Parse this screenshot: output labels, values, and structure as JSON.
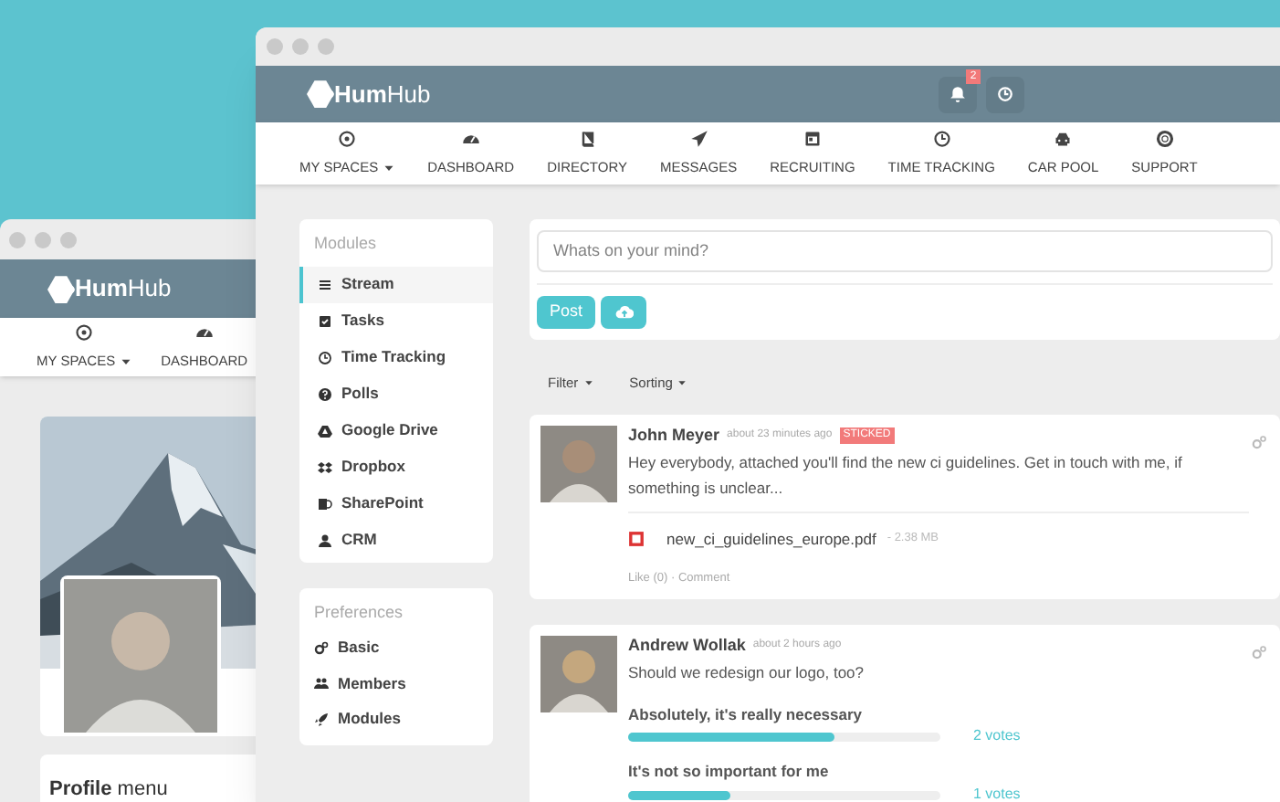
{
  "back_window": {
    "logo": "**Hum**Hub",
    "nav": [
      {
        "label": "MY SPACES",
        "dropdown": true
      },
      {
        "label": "DASHBOARD",
        "dropdown": false
      }
    ],
    "profile_menu": "**Profile** menu"
  },
  "window": {
    "logo": "**Hum**Hub",
    "notification_count": "2",
    "nav": [
      {
        "label": "MY SPACES",
        "dropdown": true
      },
      {
        "label": "DASHBOARD",
        "dropdown": false
      },
      {
        "label": "DIRECTORY",
        "dropdown": false
      },
      {
        "label": "MESSAGES",
        "dropdown": false
      },
      {
        "label": "RECRUITING",
        "dropdown": false
      },
      {
        "label": "TIME TRACKING",
        "dropdown": false
      },
      {
        "label": "CAR POOL",
        "dropdown": false
      },
      {
        "label": "SUPPORT",
        "dropdown": false
      }
    ]
  },
  "sidebar": {
    "modules_heading": "Modules",
    "modules": [
      {
        "label": "Stream",
        "selected": true
      },
      {
        "label": "Tasks",
        "selected": false
      },
      {
        "label": "Time Tracking",
        "selected": false
      },
      {
        "label": "Polls",
        "selected": false
      },
      {
        "label": "Google Drive",
        "selected": false
      },
      {
        "label": "Dropbox",
        "selected": false
      },
      {
        "label": "SharePoint",
        "selected": false
      },
      {
        "label": "CRM",
        "selected": false
      }
    ],
    "preferences_heading": "Preferences",
    "preferences": [
      {
        "label": "Basic"
      },
      {
        "label": "Members"
      },
      {
        "label": "Modules"
      }
    ]
  },
  "composer": {
    "placeholder": "Whats on your mind?",
    "post_button": "Post"
  },
  "filters": [
    "Filter",
    "Sorting"
  ],
  "posts": [
    {
      "kind": "attachment",
      "author": "John Meyer",
      "time": "about 23 minutes ago",
      "badge": "STICKED",
      "text": "Hey everybody, attached you'll find the new ci guidelines. Get in touch with me, if something is unclear...",
      "file": "new_ci_guidelines_europe.pdf",
      "size": "- 2.38 MB",
      "actions": "Like (0) · Comment"
    },
    {
      "kind": "poll",
      "author": "Andrew Wollak",
      "time": "about 2 hours ago",
      "text": "Should we redesign our logo, too?",
      "answers": [
        {
          "label": "Absolutely, it's really necessary",
          "level": 0.66,
          "votes": "2 votes"
        },
        {
          "label": "It's not so important for me",
          "level": 0.33,
          "votes": "1 votes"
        }
      ]
    }
  ]
}
